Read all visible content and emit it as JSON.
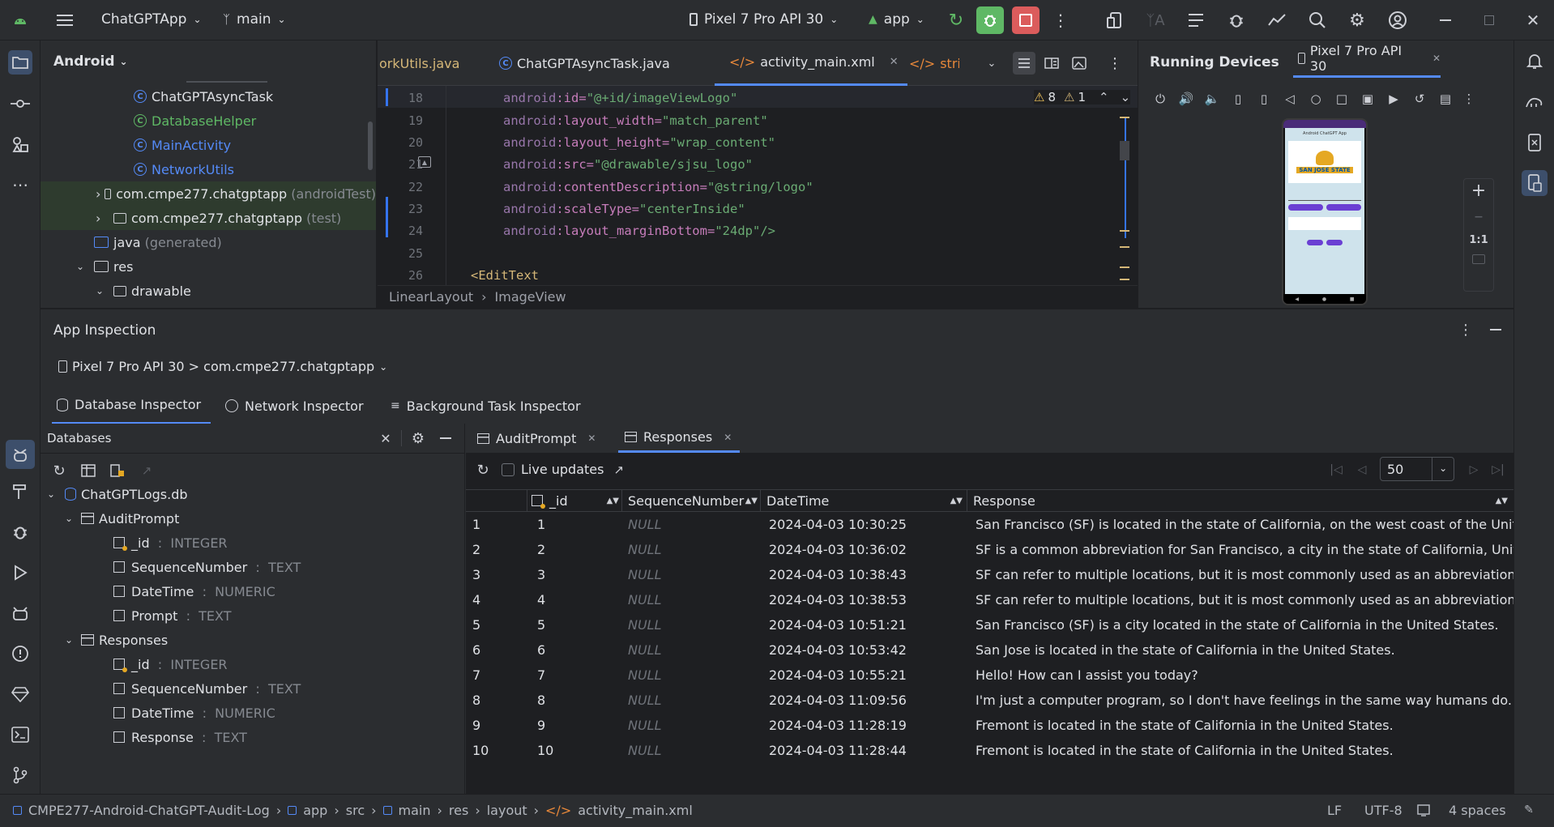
{
  "titlebar": {
    "project": "ChatGPTApp",
    "branch": "main",
    "device": "Pixel 7 Pro API 30",
    "run_config": "app"
  },
  "project_panel": {
    "view": "Android",
    "items": [
      {
        "label": "ChatGPTAsyncTask",
        "kind": "class"
      },
      {
        "label": "DatabaseHelper",
        "kind": "class"
      },
      {
        "label": "MainActivity",
        "kind": "class"
      },
      {
        "label": "NetworkUtils",
        "kind": "class"
      },
      {
        "label": "com.cmpe277.chatgptapp",
        "suffix": "(androidTest)",
        "kind": "package"
      },
      {
        "label": "com.cmpe277.chatgptapp",
        "suffix": "(test)",
        "kind": "package"
      },
      {
        "label": "java",
        "suffix": "(generated)",
        "kind": "folder"
      },
      {
        "label": "res",
        "kind": "folder"
      },
      {
        "label": "drawable",
        "kind": "folder"
      }
    ]
  },
  "editor": {
    "tabs": [
      {
        "label": "orkUtils.java"
      },
      {
        "label": "ChatGPTAsyncTask.java"
      },
      {
        "label": "activity_main.xml",
        "active": true
      },
      {
        "label": "strings.xm"
      }
    ],
    "warnings": "8",
    "weak_warnings": "1",
    "lines": [
      {
        "num": "18",
        "attr": "id",
        "value": "\"@+id/imageViewLogo\""
      },
      {
        "num": "19",
        "attr": "layout_width",
        "value": "\"match_parent\""
      },
      {
        "num": "20",
        "attr": "layout_height",
        "value": "\"wrap_content\""
      },
      {
        "num": "21",
        "attr": "src",
        "value": "\"@drawable/sjsu_logo\""
      },
      {
        "num": "22",
        "attr": "contentDescription",
        "value": "\"@string/logo\""
      },
      {
        "num": "23",
        "attr": "scaleType",
        "value": "\"centerInside\""
      },
      {
        "num": "24",
        "attr": "layout_marginBottom",
        "value": "\"24dp\"/>"
      },
      {
        "num": "25",
        "attr": "",
        "value": ""
      },
      {
        "num": "26",
        "attr": "",
        "value": ""
      }
    ],
    "ns": "android",
    "edittext_tag": "<EditText",
    "breadcrumb": [
      "LinearLayout",
      "ImageView"
    ]
  },
  "devices": {
    "title": "Running Devices",
    "tab": "Pixel 7 Pro API 30",
    "zoom_label": "1:1",
    "phone_title": "Android ChatGPT App",
    "phone_logo": "SAN JOSE STATE"
  },
  "inspection": {
    "title": "App Inspection",
    "process": "Pixel 7 Pro API 30 > com.cmpe277.chatgptapp",
    "tabs": [
      "Database Inspector",
      "Network Inspector",
      "Background Task Inspector"
    ],
    "databases_label": "Databases",
    "db_name": "ChatGPTLogs.db",
    "tables": [
      {
        "name": "AuditPrompt",
        "columns": [
          {
            "name": "_id",
            "type": "INTEGER",
            "pk": true
          },
          {
            "name": "SequenceNumber",
            "type": "TEXT"
          },
          {
            "name": "DateTime",
            "type": "NUMERIC"
          },
          {
            "name": "Prompt",
            "type": "TEXT"
          }
        ]
      },
      {
        "name": "Responses",
        "columns": [
          {
            "name": "_id",
            "type": "INTEGER",
            "pk": true
          },
          {
            "name": "SequenceNumber",
            "type": "TEXT"
          },
          {
            "name": "DateTime",
            "type": "NUMERIC"
          },
          {
            "name": "Response",
            "type": "TEXT"
          }
        ]
      }
    ],
    "result_tabs": [
      "AuditPrompt",
      "Responses"
    ],
    "live_updates": "Live updates",
    "page_size": "50",
    "headers": [
      "_id",
      "SequenceNumber",
      "DateTime",
      "Response"
    ],
    "rows": [
      [
        "1",
        "1",
        "NULL",
        "2024-04-03 10:30:25",
        "San Francisco (SF) is located in the state of California, on the west coast of the United States."
      ],
      [
        "2",
        "2",
        "NULL",
        "2024-04-03 10:36:02",
        "SF is a common abbreviation for San Francisco, a city in the state of California, United States."
      ],
      [
        "3",
        "3",
        "NULL",
        "2024-04-03 10:38:43",
        "SF can refer to multiple locations, but it is most commonly used as an abbreviation for San Francisco."
      ],
      [
        "4",
        "4",
        "NULL",
        "2024-04-03 10:38:53",
        "SF can refer to multiple locations, but it is most commonly used as an abbreviation for San Francisco."
      ],
      [
        "5",
        "5",
        "NULL",
        "2024-04-03 10:51:21",
        "San Francisco (SF) is a city located in the state of California in the United States."
      ],
      [
        "6",
        "6",
        "NULL",
        "2024-04-03 10:53:42",
        "San Jose is located in the state of California in the United States."
      ],
      [
        "7",
        "7",
        "NULL",
        "2024-04-03 10:55:21",
        "Hello! How can I assist you today?"
      ],
      [
        "8",
        "8",
        "NULL",
        "2024-04-03 11:09:56",
        "I'm just a computer program, so I don't have feelings in the same way humans do. But I'm here to help."
      ],
      [
        "9",
        "9",
        "NULL",
        "2024-04-03 11:28:19",
        "Fremont is located in the state of California in the United States."
      ],
      [
        "10",
        "10",
        "NULL",
        "2024-04-03 11:28:44",
        "Fremont is located in the state of California in the United States."
      ]
    ]
  },
  "statusbar": {
    "path": [
      "CMPE277-Android-ChatGPT-Audit-Log",
      "app",
      "src",
      "main",
      "res",
      "layout",
      "activity_main.xml"
    ],
    "line_sep": "LF",
    "encoding": "UTF-8",
    "indent": "4 spaces"
  },
  "colors": {
    "accent": "#548af7",
    "debug": "#5fb865",
    "stop": "#db5c5c",
    "bg": "#1e1f22",
    "panel": "#2b2d30"
  }
}
